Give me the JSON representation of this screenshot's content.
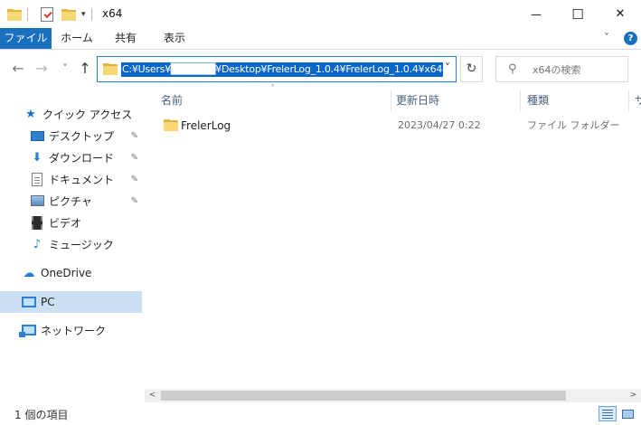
{
  "window": {
    "title": "x64",
    "minimize_glyph": "—",
    "maximize_glyph": "☐",
    "close_glyph": "✕"
  },
  "quick_access_toolbar": {
    "dropdown_glyph": "▾"
  },
  "ribbon": {
    "tabs": [
      {
        "label": "ファイル",
        "active": true
      },
      {
        "label": "ホーム"
      },
      {
        "label": "共有"
      },
      {
        "label": "表示"
      }
    ],
    "expand_glyph": "˅",
    "help_glyph": "?"
  },
  "navigation": {
    "back_glyph": "←",
    "forward_glyph": "→",
    "recent_glyph": "˅",
    "up_glyph": "↑",
    "refresh_glyph": "↻",
    "address_path": "C:¥Users¥██████¥Desktop¥FrelerLog_1.0.4¥FrelerLog_1.0.4¥x64",
    "address_dropdown_glyph": "˅",
    "search_placeholder": "x64の検索",
    "search_glyph": "⚲"
  },
  "sidebar": {
    "quick_access": {
      "label": "クイック アクセス",
      "icon": "star-icon"
    },
    "pinned": [
      {
        "label": "デスクトップ",
        "icon": "desktop-icon",
        "pinned": true
      },
      {
        "label": "ダウンロード",
        "icon": "download-icon",
        "pinned": true
      },
      {
        "label": "ドキュメント",
        "icon": "document-icon",
        "pinned": true
      },
      {
        "label": "ピクチャ",
        "icon": "pictures-icon",
        "pinned": true
      },
      {
        "label": "ビデオ",
        "icon": "video-icon",
        "pinned": false
      },
      {
        "label": "ミュージック",
        "icon": "music-icon",
        "pinned": false
      }
    ],
    "onedrive": {
      "label": "OneDrive",
      "icon": "cloud-icon"
    },
    "pc": {
      "label": "PC",
      "icon": "pc-icon",
      "selected": true
    },
    "network": {
      "label": "ネットワーク",
      "icon": "network-icon"
    },
    "pin_glyph": "📌"
  },
  "file_list": {
    "columns": [
      "名前",
      "更新日時",
      "種類",
      "サ"
    ],
    "sort_indicator": "˄",
    "rows": [
      {
        "name": "FrelerLog",
        "modified": "2023/04/27 0:22",
        "type": "ファイル フォルダー"
      }
    ]
  },
  "scrollbar": {
    "left_glyph": "<",
    "right_glyph": ">"
  },
  "status_bar": {
    "item_count": "1 個の項目",
    "active_view": "details"
  },
  "colors": {
    "accent": "#1a6fbf",
    "selection": "#cce0f4",
    "address_highlight": "#0a66c8",
    "folder": "#f8d775"
  }
}
